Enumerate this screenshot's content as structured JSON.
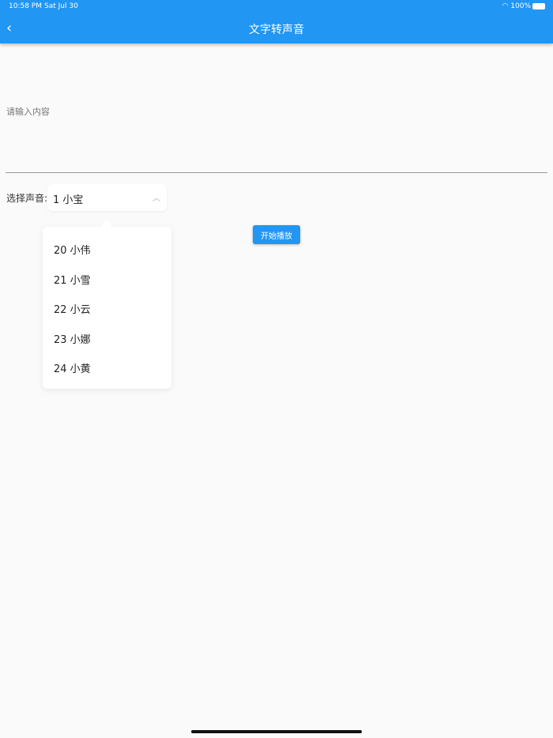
{
  "status_bar": {
    "time": "10:58 PM",
    "date": "Sat Jul 30",
    "battery": "100%"
  },
  "header": {
    "title": "文字转声音",
    "back_icon": "‹"
  },
  "text_input": {
    "placeholder": "请输入内容"
  },
  "voice_select": {
    "label": "选择声音:",
    "value": "1 小宝",
    "options": [
      "20 小伟",
      "21 小雪",
      "22 小云",
      "23 小娜",
      "24 小黄"
    ]
  },
  "play_button": {
    "label": "开始播放"
  }
}
